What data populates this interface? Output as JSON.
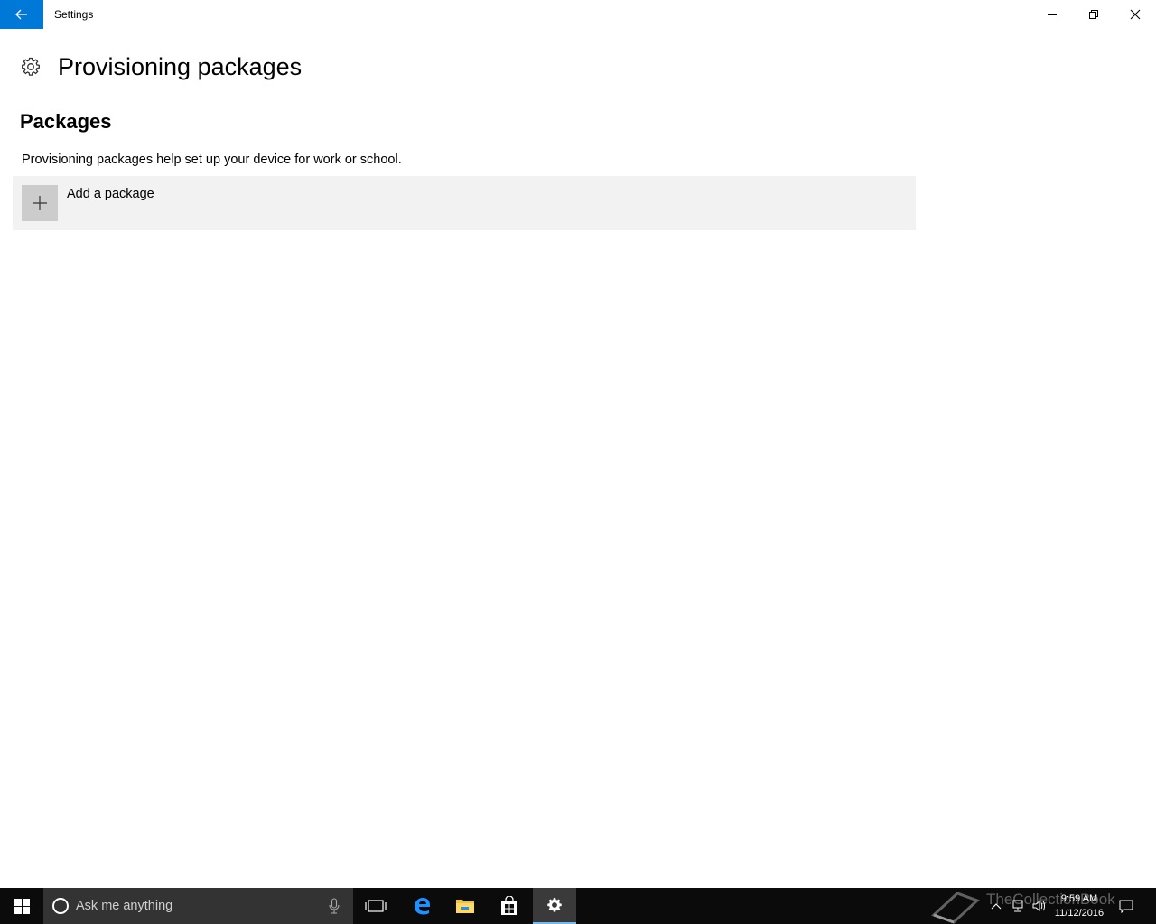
{
  "window": {
    "title": "Settings",
    "back_label": "Back",
    "controls": {
      "minimize": "minimize",
      "restore": "restore",
      "close": "close"
    }
  },
  "page": {
    "title": "Provisioning packages",
    "icon": "gear-icon"
  },
  "packages": {
    "section_title": "Packages",
    "description": "Provisioning packages help set up your device for work or school.",
    "add_label": "Add a package"
  },
  "taskbar": {
    "search_placeholder": "Ask me anything",
    "apps": [
      "task-view",
      "edge",
      "file-explorer",
      "store",
      "settings"
    ],
    "active_app": "settings",
    "accent": "#76b9ed"
  },
  "tray": {
    "time": "9:59 AM",
    "date": "11/12/2016"
  },
  "watermark": {
    "text": "TheCollectionBook"
  },
  "colors": {
    "accent": "#0078d7",
    "row_bg": "#f2f2f2",
    "taskbar_bg": "#0b0b0b"
  }
}
